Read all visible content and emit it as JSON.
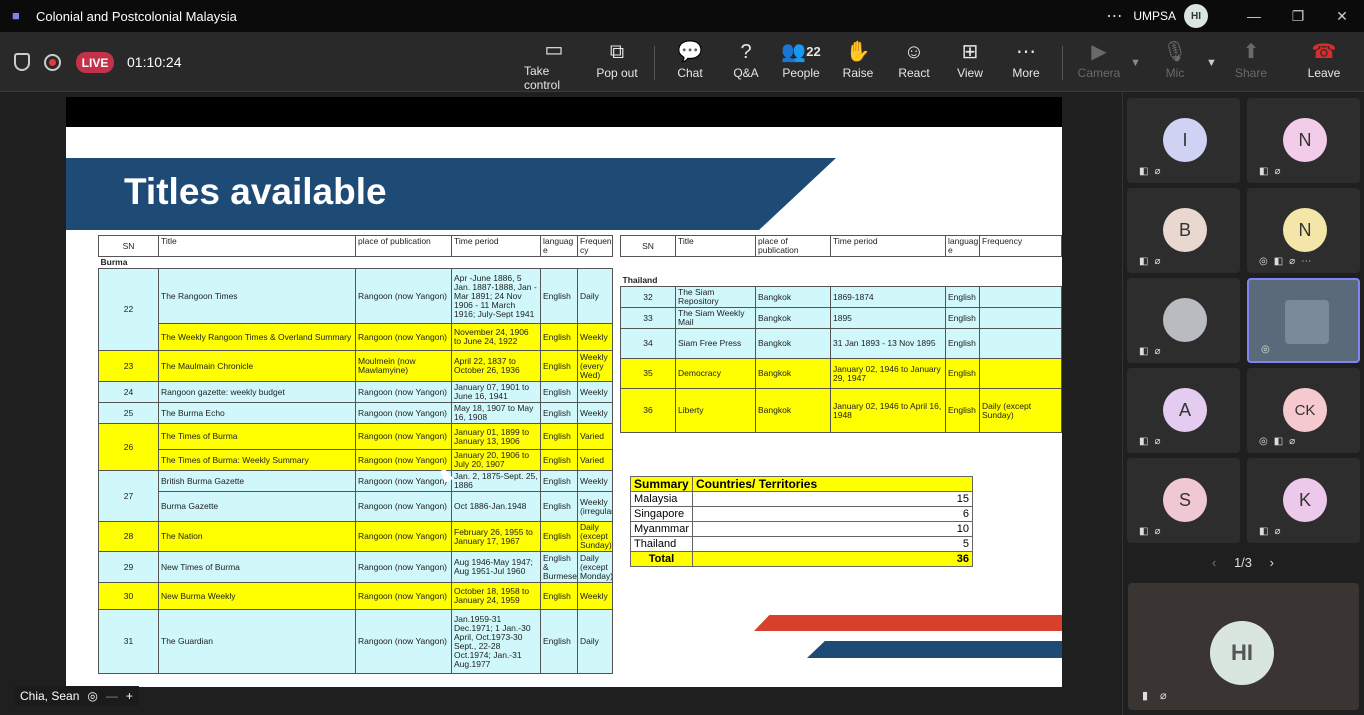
{
  "window": {
    "title": "Colonial and Postcolonial Malaysia",
    "org": "UMPSA",
    "avatar": "HI",
    "more": "⋯",
    "min": "—",
    "restore": "❐",
    "close": "✕"
  },
  "toolbar": {
    "live": "LIVE",
    "timer": "01:10:24",
    "buttons": [
      {
        "label": "Take control",
        "icon": "▭"
      },
      {
        "label": "Pop out",
        "icon": "⧉"
      },
      {
        "label": "Chat",
        "icon": "💬"
      },
      {
        "label": "Q&A",
        "icon": "?"
      },
      {
        "label": "People",
        "icon": "👥",
        "count": "22"
      },
      {
        "label": "Raise",
        "icon": "✋"
      },
      {
        "label": "React",
        "icon": "☺"
      },
      {
        "label": "View",
        "icon": "⊞"
      },
      {
        "label": "More",
        "icon": "⋯"
      },
      {
        "label": "Camera",
        "icon": "▶"
      },
      {
        "label": "Mic",
        "icon": "🎙"
      },
      {
        "label": "Share",
        "icon": "⬆"
      },
      {
        "label": "Leave",
        "icon": "☎"
      }
    ]
  },
  "slide": {
    "title": "Titles available",
    "burma_table": {
      "headers": [
        "SN",
        "Title",
        "place of publication",
        "Time period",
        "languag e",
        "Frequen cy"
      ],
      "section": "Burma",
      "rows": [
        {
          "sn": "22",
          "title": "The Rangoon Times",
          "place": "Rangoon (now Yangon)",
          "period": "Apr -June 1886, 5 Jan. 1887-1888, Jan -Mar 1891; 24 Nov 1906 - 11 March 1916; July-Sept 1941",
          "lang": "English",
          "freq": "Daily"
        },
        {
          "sn": "",
          "title": "The Weekly Rangoon Times & Overland Summary",
          "place": "Rangoon (now Yangon)",
          "period": "November 24, 1906 to June 24, 1922",
          "lang": "English",
          "freq": "Weekly"
        },
        {
          "sn": "23",
          "title": "The Maulmain Chronicle",
          "place": "Moulmein (now Mawlamyine)",
          "period": "April 22, 1837 to October 26, 1936",
          "lang": "English",
          "freq": "Weekly (every Wed)"
        },
        {
          "sn": "24",
          "title": "Rangoon gazette: weekly budget",
          "place": "Rangoon (now Yangon)",
          "period": "January 07, 1901 to June 16, 1941",
          "lang": "English",
          "freq": "Weekly"
        },
        {
          "sn": "25",
          "title": "The Burma Echo",
          "place": "Rangoon (now Yangon)",
          "period": "May 18, 1907 to May 16, 1908",
          "lang": "English",
          "freq": "Weekly"
        },
        {
          "sn": "26",
          "title": "The Times of Burma",
          "place": "Rangoon (now Yangon)",
          "period": "January 01, 1899 to January 13, 1906",
          "lang": "English",
          "freq": "Varied"
        },
        {
          "sn": "",
          "title": "The Times of Burma: Weekly Summary",
          "place": "Rangoon (now Yangon)",
          "period": "January 20, 1906 to July 20, 1907",
          "lang": "English",
          "freq": "Varied"
        },
        {
          "sn": "27",
          "title": "British Burma Gazette",
          "place": "Rangoon (now Yangon)",
          "period": "Jan. 2, 1875-Sept. 25, 1886",
          "lang": "English",
          "freq": "Weekly"
        },
        {
          "sn": "",
          "title": "Burma Gazette",
          "place": "Rangoon (now Yangon)",
          "period": "Oct 1886-Jan.1948",
          "lang": "English",
          "freq": "Weekly (irregular)"
        },
        {
          "sn": "28",
          "title": "The Nation",
          "place": "Rangoon (now Yangon)",
          "period": "February 26, 1955 to January 17, 1967",
          "lang": "English",
          "freq": "Daily (except Sunday)"
        },
        {
          "sn": "29",
          "title": "New Times of Burma",
          "place": "Rangoon (now Yangon)",
          "period": "Aug 1946-May 1947; Aug 1951-Jul 1960",
          "lang": "English & Burmese",
          "freq": "Daily (except Monday)"
        },
        {
          "sn": "30",
          "title": "New Burma Weekly",
          "place": "Rangoon (now Yangon)",
          "period": "October 18, 1958 to January 24, 1959",
          "lang": "English",
          "freq": "Weekly"
        },
        {
          "sn": "31",
          "title": "The Guardian",
          "place": "Rangoon (now Yangon)",
          "period": "Jan.1959-31 Dec.1971; 1 Jan.-30 April, Oct.1973-30 Sept., 22-28 Oct.1974; Jan.-31 Aug.1977",
          "lang": "English",
          "freq": "Daily"
        }
      ]
    },
    "thai_table": {
      "headers": [
        "SN",
        "Title",
        "place of publication",
        "Time period",
        "languag e",
        "Frequency"
      ],
      "section": "Thailand",
      "rows": [
        {
          "sn": "32",
          "title": "The Siam Repository",
          "place": "Bangkok",
          "period": "1869-1874",
          "lang": "English",
          "freq": ""
        },
        {
          "sn": "33",
          "title": "The Siam Weekly Mail",
          "place": "Bangkok",
          "period": "1895",
          "lang": "English",
          "freq": ""
        },
        {
          "sn": "34",
          "title": "Siam Free Press",
          "place": "Bangkok",
          "period": "31 Jan 1893 - 13 Nov 1895",
          "lang": "English",
          "freq": ""
        },
        {
          "sn": "35",
          "title": "Democracy",
          "place": "Bangkok",
          "period": "January 02, 1946 to January 29, 1947",
          "lang": "English",
          "freq": ""
        },
        {
          "sn": "36",
          "title": "Liberty",
          "place": "Bangkok",
          "period": "January 02, 1946 to April 16, 1948",
          "lang": "English",
          "freq": "Daily (except Sunday)"
        }
      ]
    },
    "summary": {
      "h1": "Summary",
      "h2": "Countries/ Territories",
      "rows": [
        {
          "name": "Malaysia",
          "value": "15"
        },
        {
          "name": "Singapore",
          "value": "6"
        },
        {
          "name": "Myanmmar",
          "value": "10"
        },
        {
          "name": "Thailand",
          "value": "5"
        }
      ],
      "total_label": "Total",
      "total_value": "36"
    }
  },
  "participants": [
    {
      "initial": "I",
      "color": "#cfd2f2"
    },
    {
      "initial": "N",
      "color": "#f2cce8"
    },
    {
      "initial": "B",
      "color": "#e8d8d0"
    },
    {
      "initial": "N",
      "color": "#f4e6a8"
    },
    {
      "initial": "",
      "color": "#b8bcc0"
    },
    {
      "initial": "",
      "color": "#7a8a9a"
    },
    {
      "initial": "A",
      "color": "#e4ccf0"
    },
    {
      "initial": "CK",
      "color": "#f6c9cf"
    },
    {
      "initial": "S",
      "color": "#f0c8d4"
    },
    {
      "initial": "K",
      "color": "#ecc8ea"
    }
  ],
  "pager": {
    "prev": "‹",
    "text": "1/3",
    "next": "›"
  },
  "self_view": {
    "initials": "HI"
  },
  "presenter": {
    "name": "Chia, Sean",
    "minus": "—",
    "plus": "+"
  }
}
